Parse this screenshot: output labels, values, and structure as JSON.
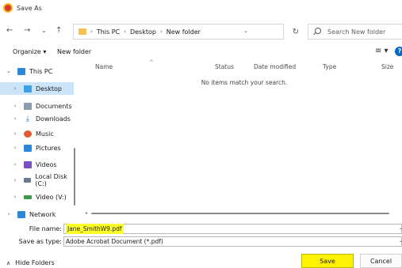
{
  "window": {
    "title": "Save As"
  },
  "nav_buttons": {
    "back": "←",
    "forward": "→",
    "recent": "⌄",
    "up": "↑"
  },
  "address": {
    "crumbs": [
      "This PC",
      "Desktop",
      "New folder"
    ],
    "separator": "›"
  },
  "search": {
    "placeholder": "Search New folder"
  },
  "commandbar": {
    "organize": "Organize ▾",
    "new_folder": "New folder",
    "view": "≡ ▾",
    "help": "?"
  },
  "sidebar": {
    "items": [
      {
        "label": "This PC",
        "caret": "⌄",
        "icon": "pc-icon",
        "color": "#2b88d8"
      },
      {
        "label": "Desktop",
        "caret": "›",
        "icon": "desktop-icon",
        "color": "#3aa0e6"
      },
      {
        "label": "Documents",
        "caret": "›",
        "icon": "documents-icon",
        "color": "#8a9bb0"
      },
      {
        "label": "Downloads",
        "caret": "›",
        "icon": "downloads-icon",
        "color": "#2b88d8"
      },
      {
        "label": "Music",
        "caret": "›",
        "icon": "music-icon",
        "color": "#e05a2b"
      },
      {
        "label": "Pictures",
        "caret": "›",
        "icon": "pictures-icon",
        "color": "#2b88d8"
      },
      {
        "label": "Videos",
        "caret": "›",
        "icon": "videos-icon",
        "color": "#7b4ec4"
      },
      {
        "label": "Local Disk (C:)",
        "caret": "›",
        "icon": "disk-icon",
        "color": "#6a7a8a"
      },
      {
        "label": "Video (V:)",
        "caret": "›",
        "icon": "drive-icon",
        "color": "#3a9a4a"
      },
      {
        "label": "Network",
        "caret": "›",
        "icon": "network-icon",
        "color": "#2b88d8"
      }
    ]
  },
  "columns": [
    "Name",
    "Status",
    "Date modified",
    "Type",
    "Size"
  ],
  "empty_message": "No items match your search.",
  "form": {
    "filename_label": "File name:",
    "filename_value": "Jane_SmithW9.pdf",
    "savetype_label": "Save as type:",
    "savetype_value": "Adobe Acrobat Document (*.pdf)"
  },
  "footer": {
    "hide_folders": "Hide Folders",
    "save": "Save",
    "cancel": "Cancel"
  },
  "colors": {
    "highlight": "#ffff2a",
    "selected_nav": "#cce4f7",
    "accent": "#0067c0"
  }
}
